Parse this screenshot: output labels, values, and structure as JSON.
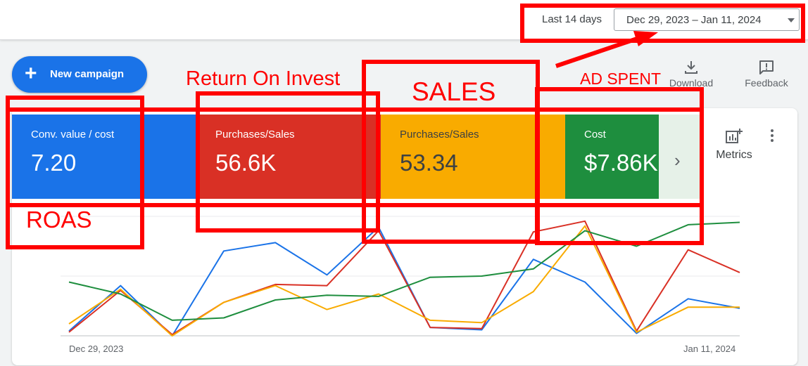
{
  "header": {
    "range_label": "Last 14 days",
    "date_range": "Dec 29, 2023 – Jan 11, 2024"
  },
  "toolbar": {
    "new_campaign_label": "New campaign",
    "download_label": "Download",
    "feedback_label": "Feedback"
  },
  "scorecards": [
    {
      "label": "Conv. value / cost",
      "value": "7.20",
      "color": "#1a73e8"
    },
    {
      "label": "Purchases/Sales",
      "value": "56.6K",
      "color": "#d93025"
    },
    {
      "label": "Purchases/Sales",
      "value": "53.34",
      "color": "#f9ab00"
    },
    {
      "label": "Cost",
      "value": "$7.86K",
      "color": "#1e8e3e"
    }
  ],
  "metrics_label": "Metrics",
  "annotations": {
    "roas": "ROAS",
    "return_on_invest": "Return On Invest",
    "sales": "SALES",
    "ad_spent": "AD SPENT",
    "color": "#ff0000"
  },
  "chart_data": {
    "type": "line",
    "x_labels": [
      "Dec 29, 2023",
      "Jan 11, 2024"
    ],
    "x": [
      "Dec 29, 2023",
      "Dec 30, 2023",
      "Dec 31, 2023",
      "Jan 1, 2024",
      "Jan 2, 2024",
      "Jan 3, 2024",
      "Jan 4, 2024",
      "Jan 5, 2024",
      "Jan 6, 2024",
      "Jan 7, 2024",
      "Jan 8, 2024",
      "Jan 9, 2024",
      "Jan 10, 2024",
      "Jan 11, 2024"
    ],
    "ylim": [
      0,
      100
    ],
    "grid": true,
    "series": [
      {
        "color": "#1a73e8",
        "values": [
          4,
          42,
          0,
          71,
          78,
          51,
          91,
          7,
          5,
          64,
          45,
          2,
          31,
          23
        ]
      },
      {
        "color": "#d93025",
        "values": [
          3,
          38,
          1,
          28,
          43,
          42,
          88,
          7,
          6,
          87,
          96,
          4,
          72,
          53
        ]
      },
      {
        "color": "#f9ab00",
        "values": [
          10,
          39,
          0,
          28,
          42,
          22,
          35,
          13,
          11,
          37,
          92,
          3,
          24,
          24
        ]
      },
      {
        "color": "#1e8e3e",
        "values": [
          45,
          35,
          13,
          15,
          30,
          34,
          33,
          49,
          50,
          56,
          88,
          75,
          93,
          95
        ]
      }
    ]
  }
}
